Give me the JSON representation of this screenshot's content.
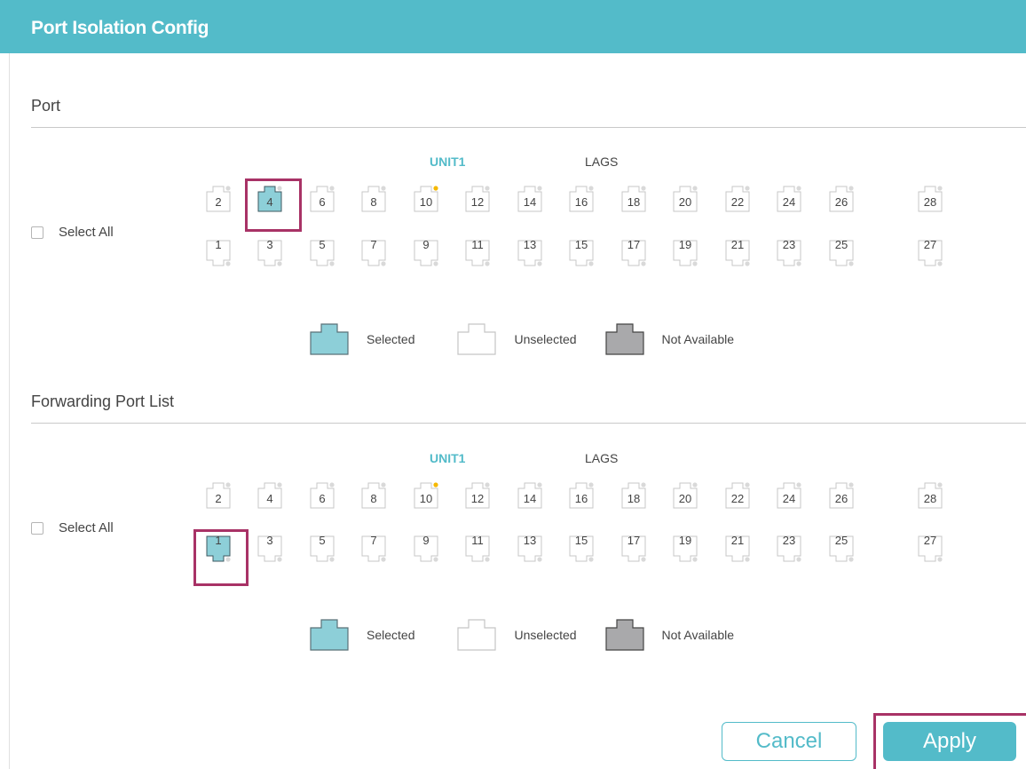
{
  "header": {
    "title": "Port Isolation Config"
  },
  "port_section": {
    "title": "Port",
    "unit_tab": "UNIT1",
    "lags_tab": "LAGS",
    "select_all": "Select All",
    "top_ports": [
      "2",
      "4",
      "6",
      "8",
      "10",
      "12",
      "14",
      "16",
      "18",
      "20",
      "22",
      "24",
      "26",
      "28"
    ],
    "bottom_ports": [
      "1",
      "3",
      "5",
      "7",
      "9",
      "11",
      "13",
      "15",
      "17",
      "19",
      "21",
      "23",
      "25",
      "27"
    ],
    "selected_ports": [
      "4"
    ],
    "active_link_ports": [
      "10"
    ]
  },
  "forwarding_section": {
    "title": "Forwarding Port List",
    "unit_tab": "UNIT1",
    "lags_tab": "LAGS",
    "select_all": "Select All",
    "top_ports": [
      "2",
      "4",
      "6",
      "8",
      "10",
      "12",
      "14",
      "16",
      "18",
      "20",
      "22",
      "24",
      "26",
      "28"
    ],
    "bottom_ports": [
      "1",
      "3",
      "5",
      "7",
      "9",
      "11",
      "13",
      "15",
      "17",
      "19",
      "21",
      "23",
      "25",
      "27"
    ],
    "selected_ports": [
      "1"
    ],
    "active_link_ports": [
      "10"
    ]
  },
  "legend": {
    "selected": "Selected",
    "unselected": "Unselected",
    "not_available": "Not Available"
  },
  "buttons": {
    "cancel": "Cancel",
    "apply": "Apply"
  },
  "colors": {
    "accent": "#53bbc9",
    "selected_fill": "#8dcfd8",
    "not_available_fill": "#a9a9ab",
    "highlight": "#a83266",
    "link_dot": "#f5b800"
  }
}
